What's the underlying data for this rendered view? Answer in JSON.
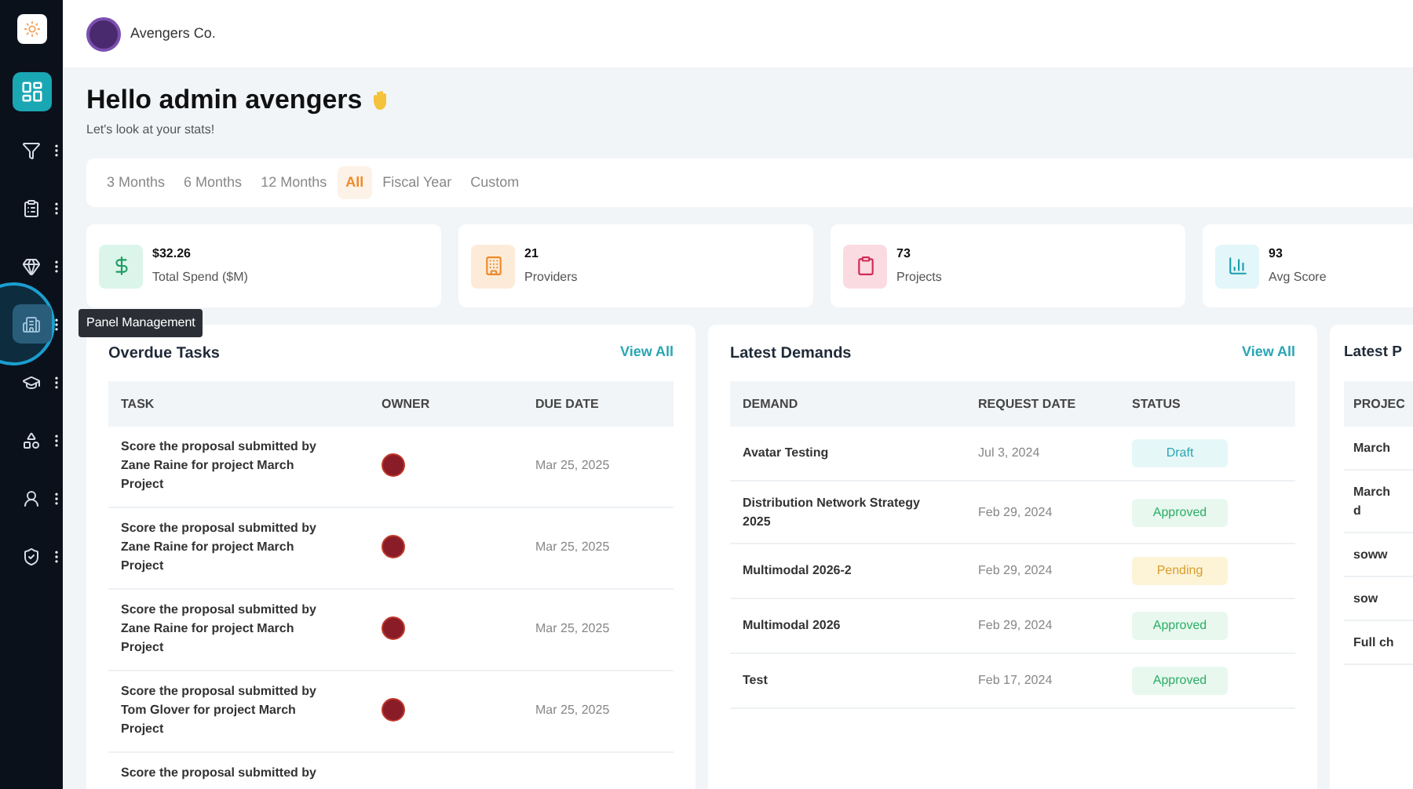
{
  "sidebar": {
    "items": [
      {
        "selected": true,
        "menu": false,
        "hovered": false
      },
      {
        "selected": false,
        "menu": true,
        "hovered": false
      },
      {
        "selected": false,
        "menu": true,
        "hovered": false
      },
      {
        "selected": false,
        "menu": true,
        "hovered": false
      },
      {
        "selected": false,
        "menu": true,
        "hovered": true,
        "tooltip": "Panel Management"
      },
      {
        "selected": false,
        "menu": true,
        "hovered": false
      },
      {
        "selected": false,
        "menu": true,
        "hovered": false
      },
      {
        "selected": false,
        "menu": true,
        "hovered": false
      },
      {
        "selected": false,
        "menu": true,
        "hovered": false
      }
    ]
  },
  "header": {
    "company": "Avengers Co."
  },
  "greeting": {
    "title": "Hello admin avengers",
    "subtitle": "Let's look at your stats!"
  },
  "periods": [
    {
      "label": "3 Months",
      "selected": false
    },
    {
      "label": "6 Months",
      "selected": false
    },
    {
      "label": "12 Months",
      "selected": false
    },
    {
      "label": "All",
      "selected": true
    },
    {
      "label": "Fiscal Year",
      "selected": false
    },
    {
      "label": "Custom",
      "selected": false
    }
  ],
  "stats": [
    {
      "kind": "spend",
      "value": "$32.26",
      "label": "Total Spend ($M)"
    },
    {
      "kind": "providers",
      "value": "21",
      "label": "Providers"
    },
    {
      "kind": "projects",
      "value": "73",
      "label": "Projects"
    },
    {
      "kind": "score",
      "value": "93",
      "label": "Avg Score"
    }
  ],
  "overdue_tasks": {
    "title": "Overdue Tasks",
    "link": "View All",
    "columns": [
      "TASK",
      "OWNER",
      "DUE DATE"
    ],
    "rows": [
      {
        "task": "Score the proposal submitted by Zane Raine for project March Project",
        "due_date": "Mar 25, 2025"
      },
      {
        "task": "Score the proposal submitted by Zane Raine for project March Project",
        "due_date": "Mar 25, 2025"
      },
      {
        "task": "Score the proposal submitted by Zane Raine for project March Project",
        "due_date": "Mar 25, 2025"
      },
      {
        "task": "Score the proposal submitted by Tom Glover for project March Project",
        "due_date": "Mar 25, 2025"
      },
      {
        "task": "Score the proposal submitted by"
      }
    ]
  },
  "latest_demands": {
    "title": "Latest Demands",
    "link": "View All",
    "columns": [
      "DEMAND",
      "REQUEST DATE",
      "STATUS"
    ],
    "rows": [
      {
        "demand": "Avatar Testing",
        "date": "Jul 3, 2024",
        "status": "Draft",
        "kind": "draft"
      },
      {
        "demand": "Distribution Network Strategy 2025",
        "date": "Feb 29, 2024",
        "status": "Approved",
        "kind": "approved"
      },
      {
        "demand": "Multimodal 2026-2",
        "date": "Feb 29, 2024",
        "status": "Pending",
        "kind": "pending"
      },
      {
        "demand": "Multimodal 2026",
        "date": "Feb 29, 2024",
        "status": "Approved",
        "kind": "approved"
      },
      {
        "demand": "Test",
        "date": "Feb 17, 2024",
        "status": "Approved",
        "kind": "approved"
      }
    ]
  },
  "latest_panel": {
    "title": "Latest P",
    "columns": [
      "PROJEC"
    ],
    "rows": [
      "March",
      "March d",
      "soww",
      "sow",
      "Full ch"
    ]
  }
}
